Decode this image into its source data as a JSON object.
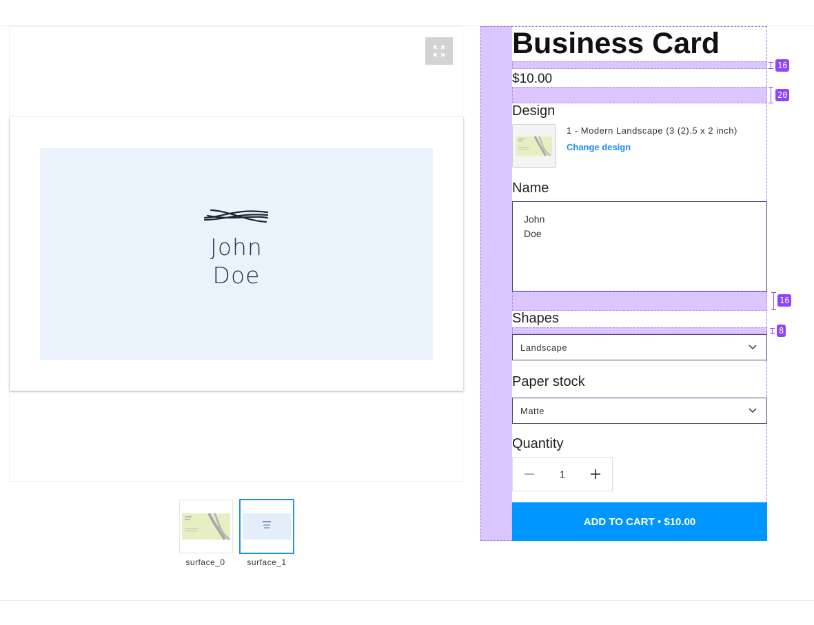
{
  "product": {
    "title": "Business Card",
    "price": "$10.00"
  },
  "preview": {
    "card_name_line1": "John",
    "card_name_line2": "Doe",
    "thumbnails": [
      {
        "label": "surface_0"
      },
      {
        "label": "surface_1"
      }
    ]
  },
  "design": {
    "label": "Design",
    "name": "1 - Modern Landscape (3 (2).5 x 2 inch)",
    "change_link": "Change design"
  },
  "name_field": {
    "label": "Name",
    "value_line1": "John",
    "value_line2": "Doe"
  },
  "shapes": {
    "label": "Shapes",
    "selected": "Landscape"
  },
  "paper_stock": {
    "label": "Paper stock",
    "selected": "Matte"
  },
  "quantity": {
    "label": "Quantity",
    "value": "1"
  },
  "cart": {
    "button_label": "ADD TO CART • $10.00"
  },
  "measurements": {
    "gap_title_price": "16",
    "gap_price_design": "20",
    "gap_name_shapes": "16",
    "gap_shapes_select": "8"
  },
  "colors": {
    "accent": "#0096ff",
    "link": "#1a8cff",
    "selected_thumb_border": "#1e90ff",
    "overlay_spacing": "#dcc6ff",
    "overlay_badge": "#8e44ff"
  },
  "icons": [
    "expand-icon",
    "chevron-down-icon",
    "minus-icon",
    "plus-icon",
    "card-logo-icon"
  ]
}
